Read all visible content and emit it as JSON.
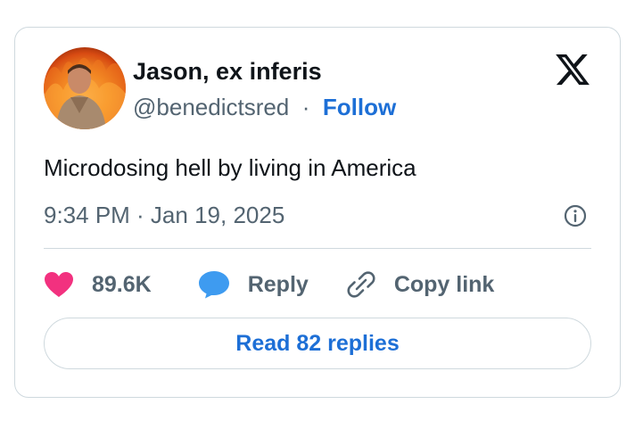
{
  "author": {
    "display_name": "Jason, ex inferis",
    "handle": "@benedictsred",
    "separator": "·",
    "follow_label": "Follow",
    "avatar_icon": "avatar-fire-photo"
  },
  "brand": {
    "logo_icon": "x-logo-icon"
  },
  "tweet": {
    "text": "Microdosing hell by living in America",
    "timestamp": "9:34 PM · Jan 19, 2025",
    "info_icon": "info-icon"
  },
  "actions": {
    "likes_count": "89.6K",
    "like_icon": "heart-icon",
    "reply_label": "Reply",
    "reply_icon": "speech-bubble-icon",
    "copy_label": "Copy link",
    "copy_icon": "link-icon"
  },
  "footer": {
    "read_replies_label": "Read 82 replies"
  },
  "colors": {
    "accent_blue": "#1d6fd6",
    "like_pink": "#f2317f",
    "reply_blue": "#3e9bf0",
    "muted_text": "#536471",
    "border": "#cfd9de"
  }
}
